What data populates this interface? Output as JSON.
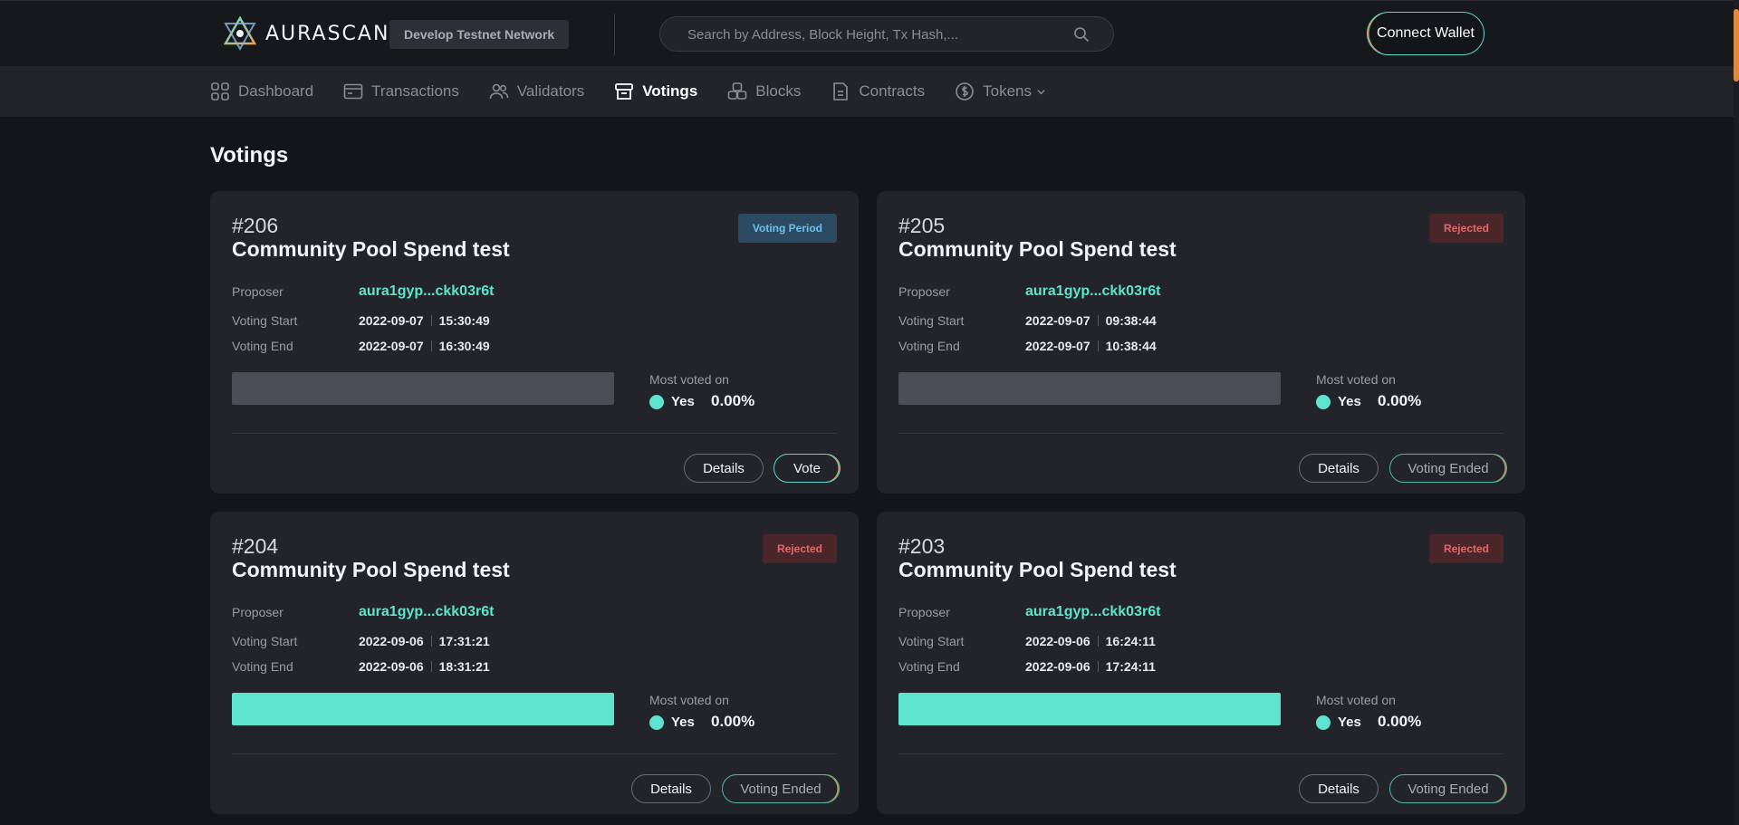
{
  "header": {
    "logo_text": "AURASCAN",
    "network": "Develop Testnet Network",
    "search_placeholder": "Search by Address, Block Height, Tx Hash,...",
    "connect_label": "Connect Wallet"
  },
  "nav": [
    {
      "label": "Dashboard",
      "icon": "dashboard-icon",
      "active": false
    },
    {
      "label": "Transactions",
      "icon": "transactions-icon",
      "active": false
    },
    {
      "label": "Validators",
      "icon": "validators-icon",
      "active": false
    },
    {
      "label": "Votings",
      "icon": "votings-icon",
      "active": true
    },
    {
      "label": "Blocks",
      "icon": "blocks-icon",
      "active": false
    },
    {
      "label": "Contracts",
      "icon": "contracts-icon",
      "active": false
    },
    {
      "label": "Tokens",
      "icon": "tokens-icon",
      "active": false
    }
  ],
  "page": {
    "title": "Votings"
  },
  "labels": {
    "proposer": "Proposer",
    "voting_start": "Voting Start",
    "voting_end": "Voting End",
    "most_voted_on": "Most voted on",
    "details": "Details"
  },
  "colors": {
    "accent": "#5fe3d1",
    "rejected": "#e06a6a",
    "voting_period": "#6cc0ec",
    "background": "#141518",
    "card": "#22242a"
  },
  "proposals": [
    {
      "id": "#206",
      "title": "Community Pool Spend test",
      "status": "Voting Period",
      "status_type": "voting",
      "proposer": "aura1gyp...ckk03r6t",
      "start_date": "2022-09-07",
      "start_time": "15:30:49",
      "end_date": "2022-09-07",
      "end_time": "16:30:49",
      "bar_fill": 0,
      "most_voted_option": "Yes",
      "most_voted_percent": "0.00%",
      "action": "Vote"
    },
    {
      "id": "#205",
      "title": "Community Pool Spend test",
      "status": "Rejected",
      "status_type": "rejected",
      "proposer": "aura1gyp...ckk03r6t",
      "start_date": "2022-09-07",
      "start_time": "09:38:44",
      "end_date": "2022-09-07",
      "end_time": "10:38:44",
      "bar_fill": 0,
      "most_voted_option": "Yes",
      "most_voted_percent": "0.00%",
      "action": "Voting Ended"
    },
    {
      "id": "#204",
      "title": "Community Pool Spend test",
      "status": "Rejected",
      "status_type": "rejected",
      "proposer": "aura1gyp...ckk03r6t",
      "start_date": "2022-09-06",
      "start_time": "17:31:21",
      "end_date": "2022-09-06",
      "end_time": "18:31:21",
      "bar_fill": 1,
      "most_voted_option": "Yes",
      "most_voted_percent": "0.00%",
      "action": "Voting Ended"
    },
    {
      "id": "#203",
      "title": "Community Pool Spend test",
      "status": "Rejected",
      "status_type": "rejected",
      "proposer": "aura1gyp...ckk03r6t",
      "start_date": "2022-09-06",
      "start_time": "16:24:11",
      "end_date": "2022-09-06",
      "end_time": "17:24:11",
      "bar_fill": 1,
      "most_voted_option": "Yes",
      "most_voted_percent": "0.00%",
      "action": "Voting Ended"
    }
  ]
}
